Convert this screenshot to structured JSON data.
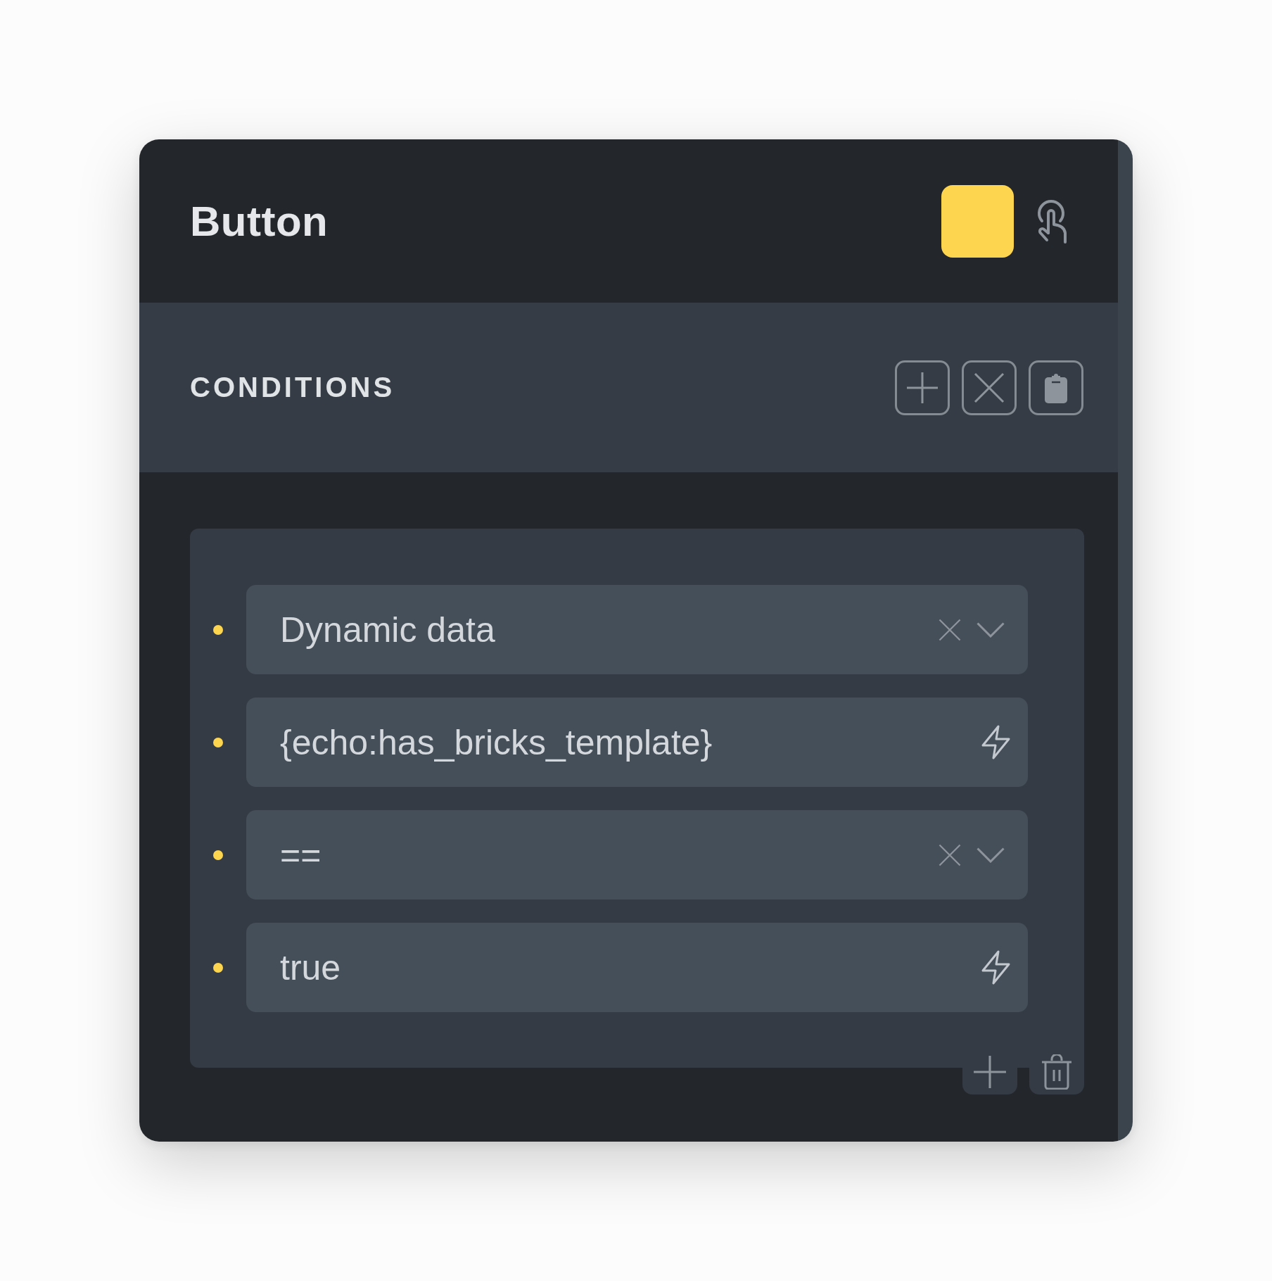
{
  "header": {
    "title": "Button",
    "tools": [
      {
        "kind": "conditions",
        "selected": true
      },
      {
        "kind": "interactions",
        "selected": false
      }
    ]
  },
  "conditions": {
    "heading": "CONDITIONS",
    "rows": [
      {
        "kind": "select",
        "value": "Dynamic data"
      },
      {
        "kind": "text",
        "value": "{echo:has_bricks_template}"
      },
      {
        "kind": "select",
        "value": "=="
      },
      {
        "kind": "text",
        "value": "true"
      }
    ]
  }
}
